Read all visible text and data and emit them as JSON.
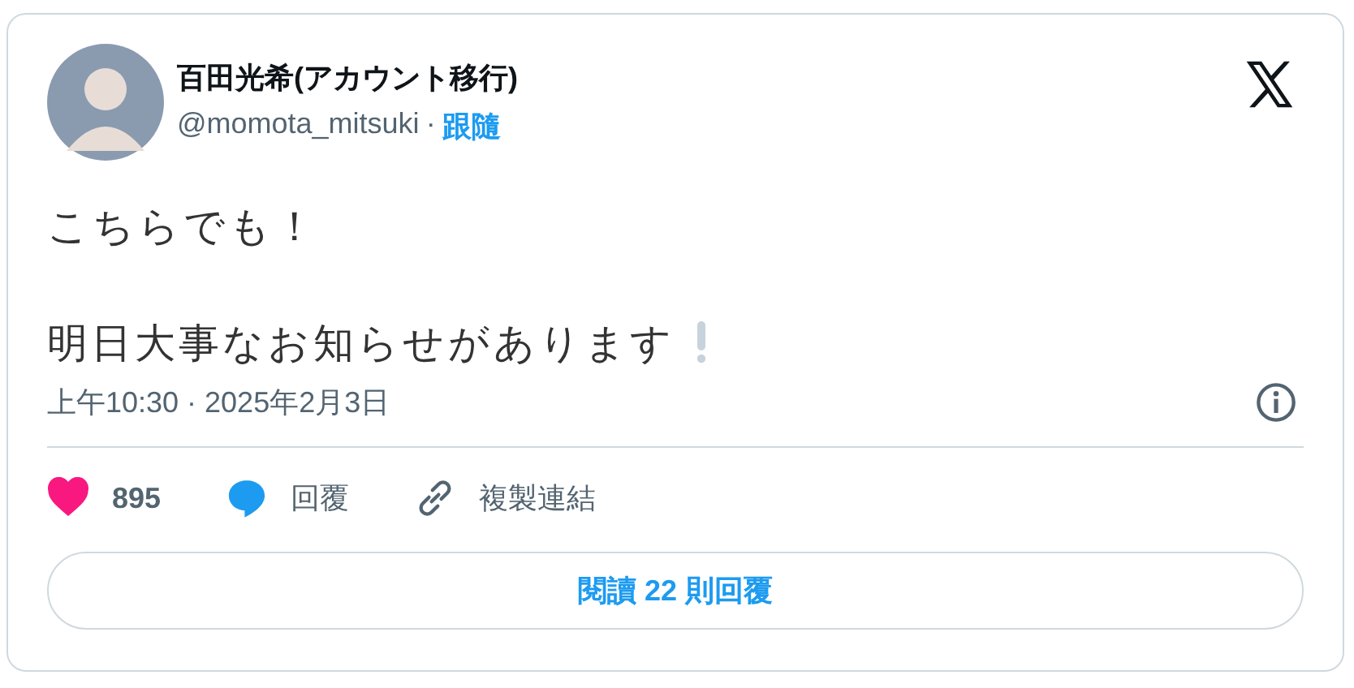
{
  "author": {
    "name": "百田光希(アカウント移行)",
    "handle": "@momota_mitsuki",
    "separator": "·",
    "follow": "跟隨"
  },
  "body": {
    "lines": [
      "こちらでも！",
      "明日大事なお知らせがあります"
    ],
    "trailing_icon": true
  },
  "timestamp": "上午10:30 · 2025年2月3日",
  "actions": [
    {
      "kind": "like",
      "label": "895",
      "liked": true
    },
    {
      "kind": "reply",
      "label": "回覆"
    },
    {
      "kind": "copy",
      "label": "複製連結"
    }
  ],
  "read_replies": "閱讀 22 則回覆"
}
